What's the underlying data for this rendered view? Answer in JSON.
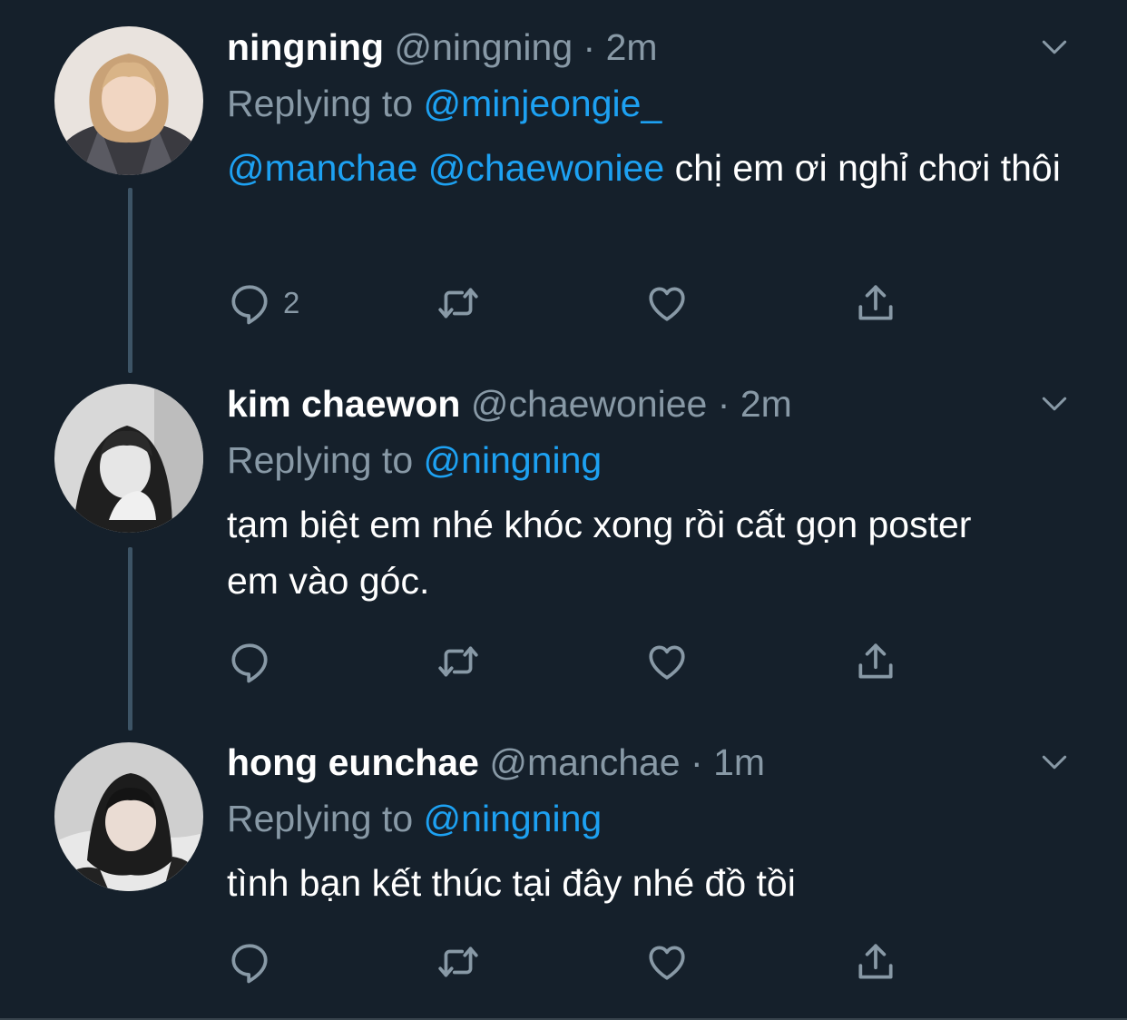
{
  "colors": {
    "background": "#15202b",
    "text": "#ffffff",
    "muted": "#8899a6",
    "link": "#1da1f2",
    "thread_line": "#3d5466"
  },
  "tweets": [
    {
      "name": "ningning",
      "handle": "@ningning",
      "separator": "·",
      "time": "2m",
      "replying_label": "Replying to",
      "replying_to": "@minjeongie_",
      "mentions": [
        "@manchae",
        "@chaewoniee"
      ],
      "text": "chị em ơi nghỉ chơi thôi",
      "reply_count": "2",
      "icons": [
        "reply-icon",
        "retweet-icon",
        "like-icon",
        "share-icon",
        "chevron-down-icon"
      ]
    },
    {
      "name": "kim chaewon",
      "handle": "@chaewoniee",
      "separator": "·",
      "time": "2m",
      "replying_label": "Replying to",
      "replying_to": "@ningning",
      "text": "tạm biệt em nhé khóc xong rồi cất gọn poster em vào góc.",
      "icons": [
        "reply-icon",
        "retweet-icon",
        "like-icon",
        "share-icon",
        "chevron-down-icon"
      ]
    },
    {
      "name": "hong eunchae",
      "handle": "@manchae",
      "separator": "·",
      "time": "1m",
      "replying_label": "Replying to",
      "replying_to": "@ningning",
      "text": "tình bạn kết thúc tại đây nhé đồ tồi",
      "icons": [
        "reply-icon",
        "retweet-icon",
        "like-icon",
        "share-icon",
        "chevron-down-icon"
      ]
    }
  ]
}
